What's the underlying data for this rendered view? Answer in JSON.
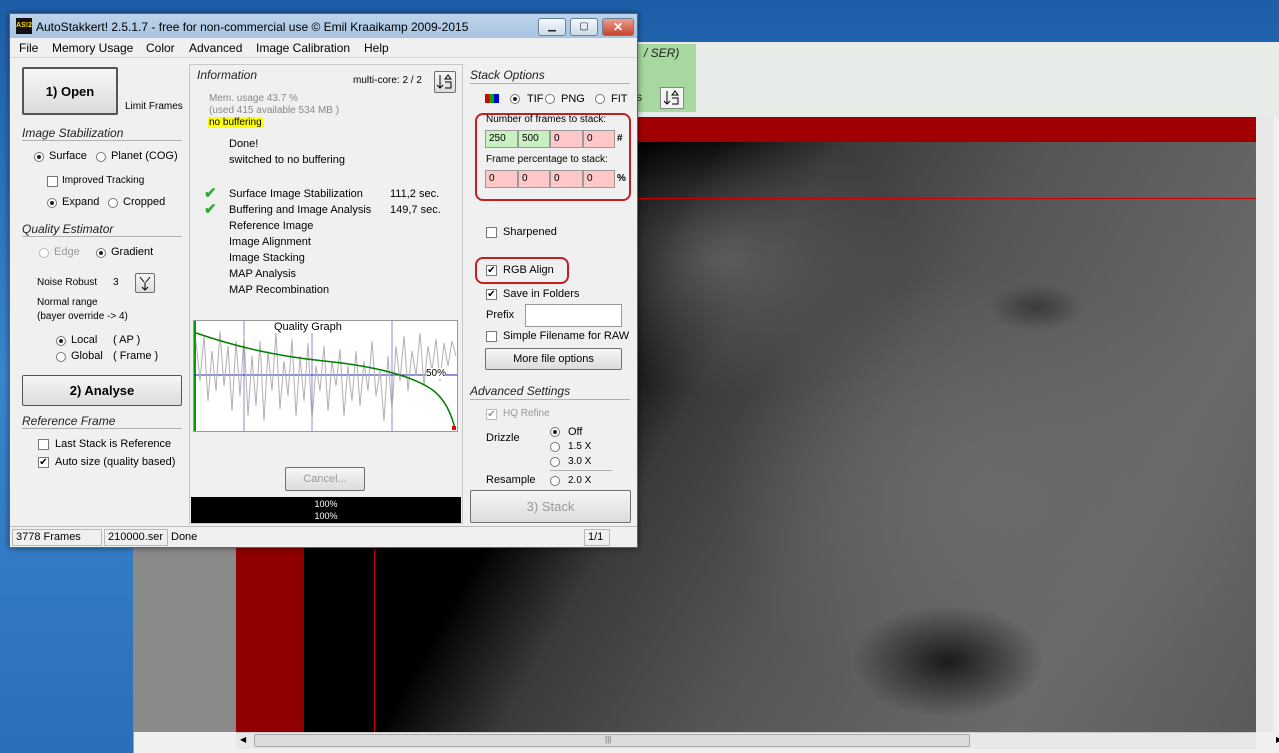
{
  "background": {
    "bg_text_top": "/ SER)",
    "bg_text_mid": "s"
  },
  "window": {
    "title": "AutoStakkert! 2.5.1.7 - free for non-commercial use © Emil Kraaikamp 2009-2015",
    "icon_text": "AS!2",
    "min_label": "▁",
    "max_label": "▢",
    "close_label": "✕"
  },
  "menu": {
    "file": "File",
    "memory": "Memory Usage",
    "color": "Color",
    "advanced": "Advanced",
    "calibration": "Image Calibration",
    "help": "Help"
  },
  "left": {
    "open": "1) Open",
    "limit_frames": "Limit Frames",
    "stab_title": "Image Stabilization",
    "surface": "Surface",
    "planet": "Planet (COG)",
    "improved": "Improved Tracking",
    "expand": "Expand",
    "cropped": "Cropped",
    "quality_title": "Quality Estimator",
    "edge": "Edge",
    "gradient": "Gradient",
    "noise": "Noise Robust",
    "noise_val": "3",
    "normal_range": "Normal range",
    "bayer": "(bayer override -> 4)",
    "local": "Local",
    "local_ap": "( AP )",
    "global": "Global",
    "global_frame": "( Frame )",
    "analyse": "2) Analyse",
    "ref_title": "Reference Frame",
    "last_stack": "Last Stack is Reference",
    "auto_size": "Auto size (quality based)"
  },
  "info": {
    "title": "Information",
    "multicore": "multi-core: 2 / 2",
    "mem1": "Mem. usage 43.7 %",
    "mem2": "(used 415 available 534 MB )",
    "buffering": "no buffering",
    "done": "Done!",
    "switched": "switched to no buffering",
    "steps": [
      {
        "label": "Surface Image Stabilization",
        "time": "111,2 sec.",
        "ok": "✔"
      },
      {
        "label": "Buffering and Image Analysis",
        "time": "149,7 sec.",
        "ok": "✔"
      },
      {
        "label": "Reference Image",
        "time": "",
        "ok": ""
      },
      {
        "label": "Image Alignment",
        "time": "",
        "ok": ""
      },
      {
        "label": "Image Stacking",
        "time": "",
        "ok": ""
      },
      {
        "label": "MAP Analysis",
        "time": "",
        "ok": ""
      },
      {
        "label": "MAP Recombination",
        "time": "",
        "ok": ""
      }
    ],
    "graph_title": "Quality Graph",
    "graph_pct": "50%",
    "cancel": "Cancel...",
    "progress1": "100%",
    "progress2": "100%"
  },
  "stack": {
    "title": "Stack Options",
    "tif": "TIF",
    "png": "PNG",
    "fit": "FIT",
    "frames_label": "Number of frames to stack:",
    "frames": [
      "250",
      "500",
      "0",
      "0"
    ],
    "frames_unit": "#",
    "pct_label": "Frame percentage to stack:",
    "pct": [
      "0",
      "0",
      "0",
      "0"
    ],
    "pct_unit": "%",
    "sharpened": "Sharpened",
    "rgb_align": "RGB Align",
    "save_folders": "Save in Folders",
    "prefix": "Prefix",
    "prefix_value": "",
    "simple_filename": "Simple Filename for RAW",
    "more_file": "More file options",
    "adv_title": "Advanced Settings",
    "hq_refine": "HQ Refine",
    "drizzle": "Drizzle",
    "off": "Off",
    "x15": "1.5 X",
    "x30": "3.0 X",
    "resample": "Resample",
    "x20": "2.0 X",
    "stack_btn": "3) Stack"
  },
  "status": {
    "frames": "3778 Frames",
    "file": "210000.ser",
    "state": "Done",
    "page": "1/1"
  },
  "scroll": {
    "left_arrow": "◀",
    "right_arrow": "▶",
    "grip": "|||"
  }
}
